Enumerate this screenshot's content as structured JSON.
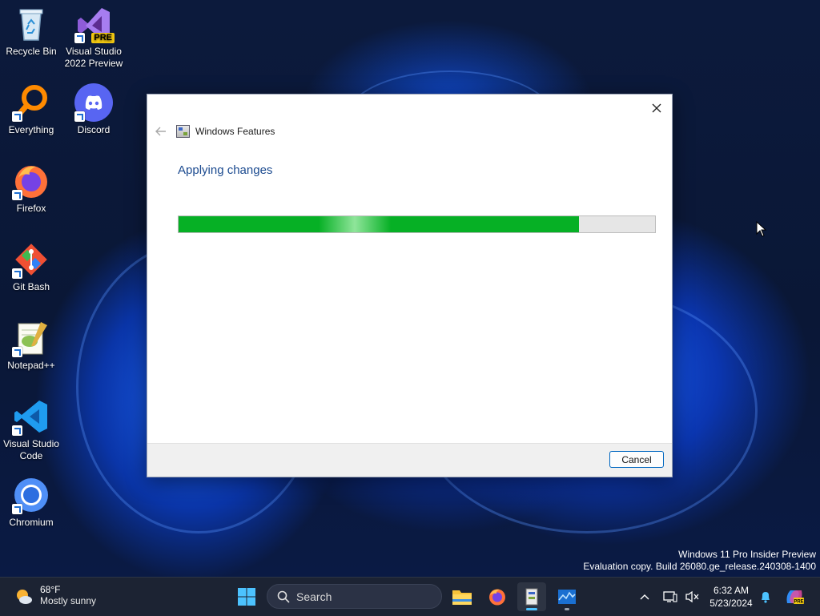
{
  "desktop": {
    "icons": [
      {
        "label": "Recycle Bin"
      },
      {
        "label": "Visual Studio 2022 Preview",
        "badge": "PRE"
      },
      {
        "label": "Everything"
      },
      {
        "label": "Discord"
      },
      {
        "label": "Firefox"
      },
      {
        "label": "Git Bash"
      },
      {
        "label": "Notepad++"
      },
      {
        "label": "Visual Studio Code"
      },
      {
        "label": "Chromium"
      }
    ]
  },
  "dialog": {
    "window_title": "Windows Features",
    "heading": "Applying changes",
    "progress_fraction": 0.84,
    "cancel_label": "Cancel",
    "close_icon": "close-icon",
    "back_icon": "back-arrow-icon"
  },
  "watermark": {
    "line1": "Windows 11 Pro Insider Preview",
    "line2": "Evaluation copy. Build 26080.ge_release.240308-1400"
  },
  "taskbar": {
    "weather": {
      "temp": "68°F",
      "condition": "Mostly sunny"
    },
    "search_label": "Search",
    "clock": {
      "time": "6:32 AM",
      "date": "5/23/2024"
    },
    "accent_color": "#4cc2ff"
  },
  "colors": {
    "progress_green": "#06b025",
    "heading_blue": "#1b4a8f",
    "button_border": "#0067c0"
  }
}
